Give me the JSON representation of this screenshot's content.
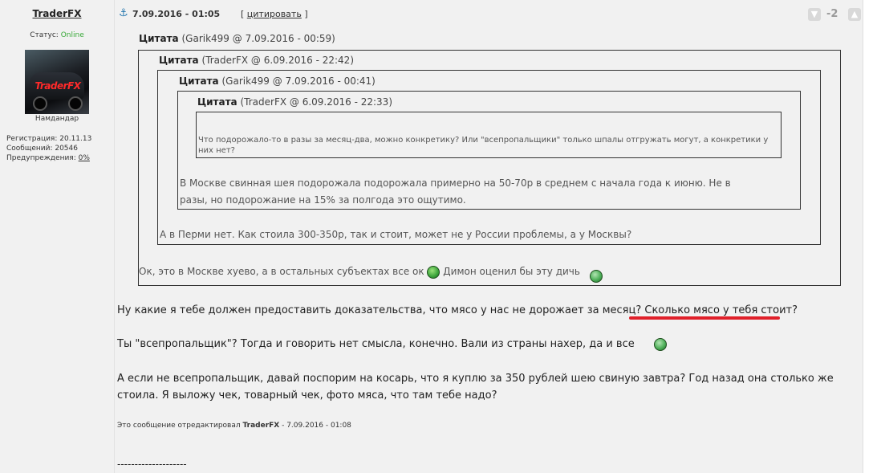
{
  "user": {
    "name": "TraderFX",
    "status_label": "Статус:",
    "status_value": "Online",
    "avatar_text": "TraderFX",
    "rank": "Намдандар",
    "stats": {
      "reg_label": "Регистрация:",
      "reg_value": "20.11.13",
      "msgs_label": "Сообщений:",
      "msgs_value": "20546",
      "warn_label": "Предупреждения:",
      "warn_value": "0%"
    }
  },
  "post": {
    "date": "7.09.2016 - 01:05",
    "quote_open": "[",
    "quote_label": "цитировать",
    "quote_close": "]",
    "rating": "-2"
  },
  "quotes": {
    "label": "Цитата",
    "q1_meta": "(Garik499 @ 7.09.2016 - 00:59)",
    "q2_meta": "(TraderFX @ 6.09.2016 - 22:42)",
    "q3_meta": "(Garik499 @ 7.09.2016 - 00:41)",
    "q4_meta": "(TraderFX @ 6.09.2016 - 22:33)",
    "q4_text": "Что подорожало-то в разы за месяц-два, можно конкретику? Или \"всепропальщики\" только шпалы отгружать могут, а конкретики у них нет?",
    "q3_text_1": "В Москве свинная шея подорожала подорожала примерно на 50-70р в среднем с начала года к июню. Не в",
    "q3_text_2": "разы, но подорожание на 15% за полгода это ощутимо.",
    "q2_text": "А в Перми нет. Как стоила 300-350р, так и стоит, может не у России проблемы, а у Москвы?",
    "q1_text_a": "Ок, это в Москве хуево, а в остальных субъектах все ок",
    "q1_text_b": "Димон оценил бы эту дичь"
  },
  "message": {
    "p1_a": "Ну какие я тебе должен предоставить доказательства, что мясо у нас не дорожает за месяц?",
    "p1_b": "Сколько мясо у тебя стоит?",
    "p2": "Ты \"всепропальщик\"? Тогда и говорить нет смысла, конечно. Вали из страны нахер, да и все",
    "p3_1": "А если не всепропальщик, давай поспорим на косарь, что я куплю за 350 рублей шею свиную завтра? Год назад она столько же",
    "p3_2": "стоила. Я выложу чек, товарный чек, фото мяса, что там тебе надо?",
    "edited_prefix": "Это сообщение отредактировал",
    "edited_user": "TraderFX",
    "edited_suffix": "- 7.09.2016 - 01:08",
    "signature": "--------------------"
  },
  "colors": {
    "panel_bg": "#f1f1f1",
    "online": "#39a939",
    "underline_mark": "#e0202a",
    "link": "#2a7ab0"
  },
  "icons": [
    "anchor-icon",
    "thumb-down-icon",
    "thumb-up-icon",
    "smiley-icon",
    "grin-smiley-icon"
  ]
}
